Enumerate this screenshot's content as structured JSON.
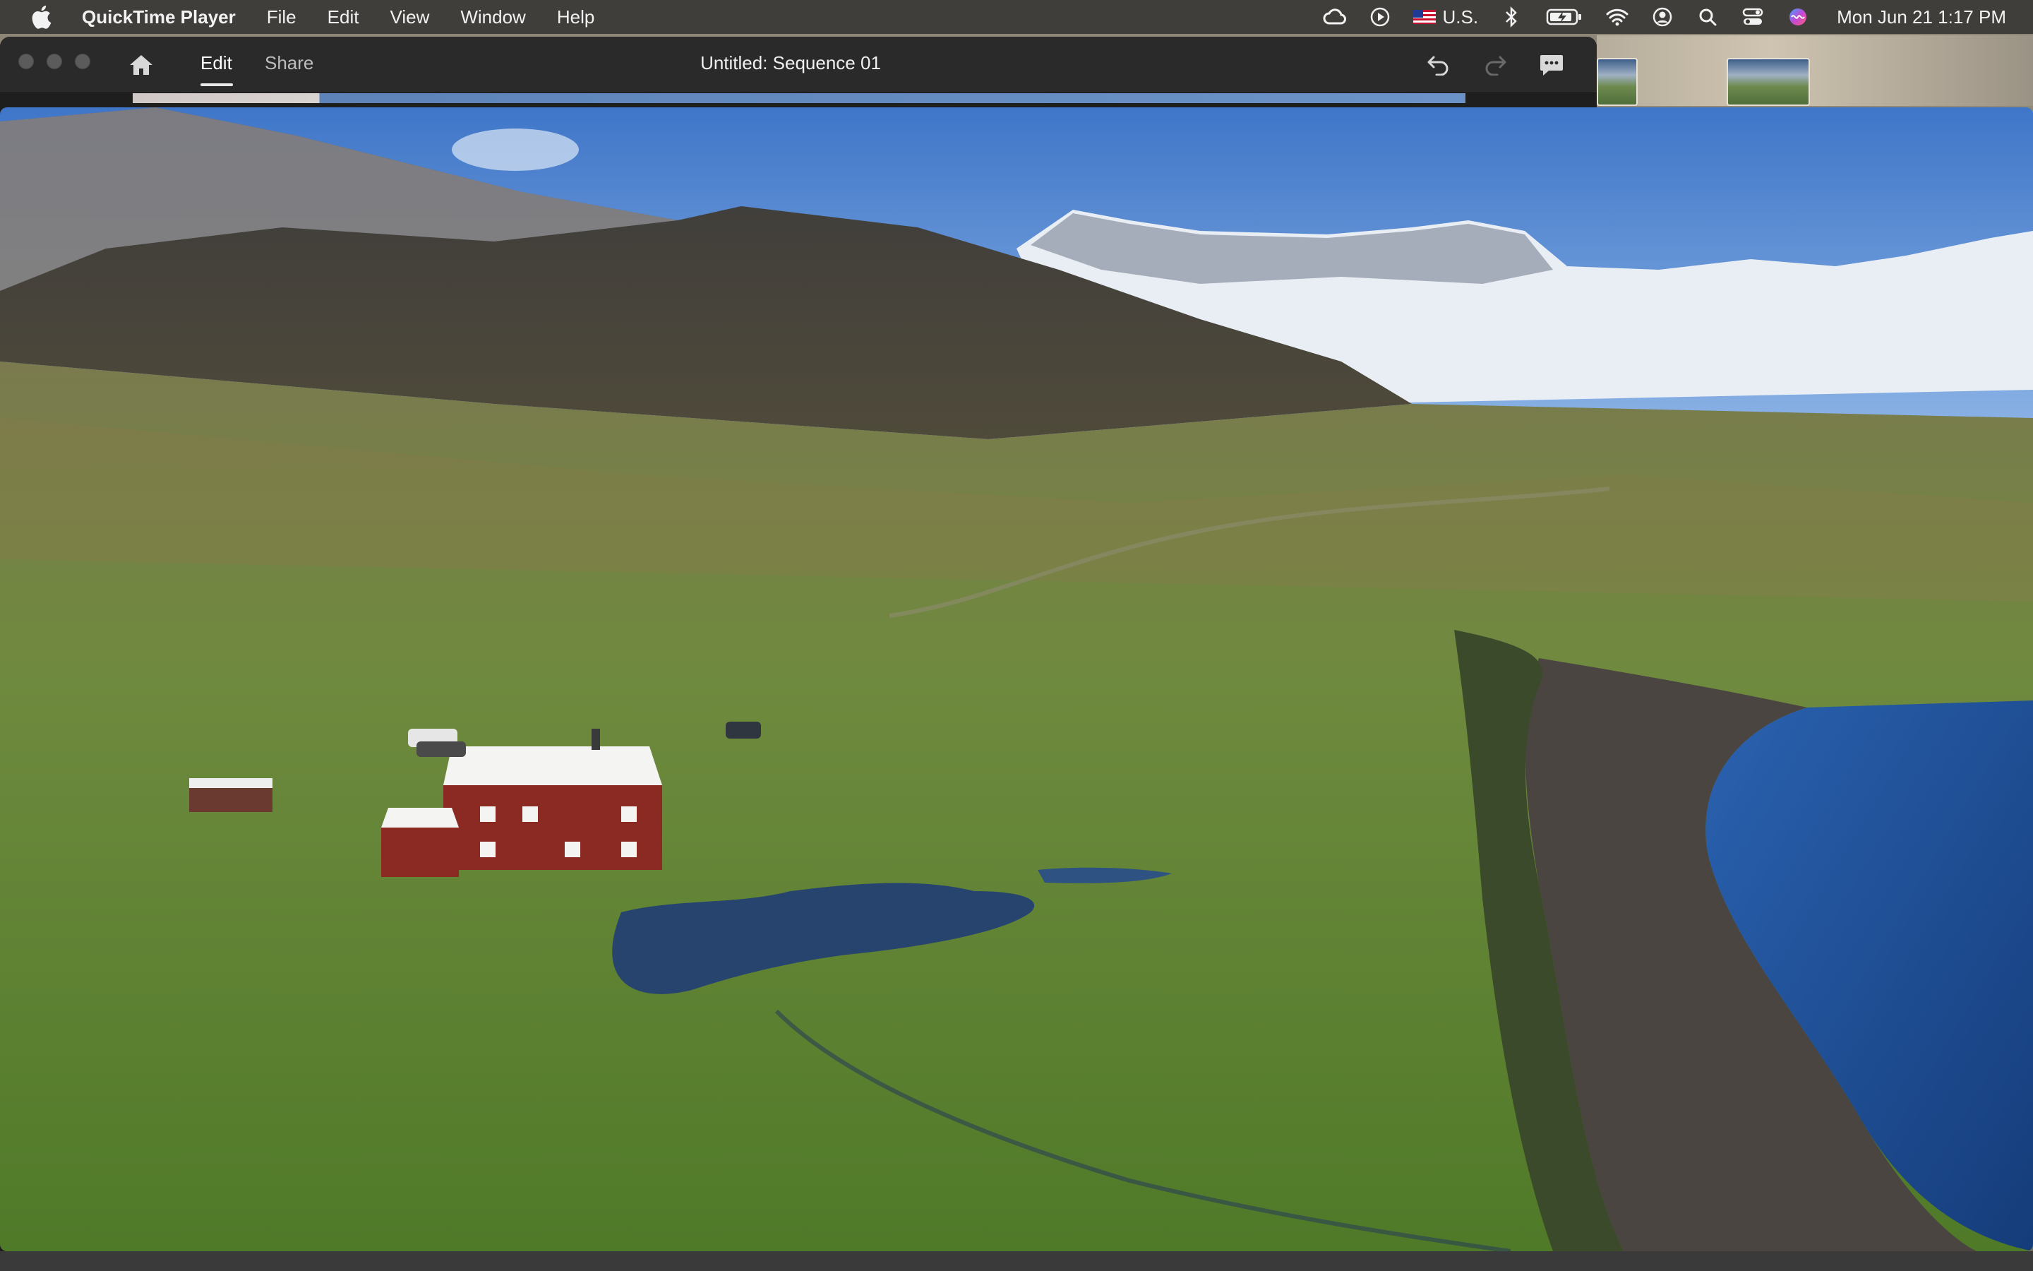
{
  "menubar": {
    "app_name": "QuickTime Player",
    "items": [
      "File",
      "Edit",
      "View",
      "Window",
      "Help"
    ],
    "input_source": "U.S.",
    "clock": "Mon Jun 21  1:17 PM"
  },
  "window": {
    "title": "Untitled: Sequence 01",
    "tabs": [
      {
        "label": "Edit",
        "active": true
      },
      {
        "label": "Share",
        "active": false
      }
    ]
  },
  "icons": {
    "apple": "apple-icon",
    "home": "home-icon",
    "undo": "undo-icon",
    "redo": "redo-icon",
    "comments": "speech-bubble-icon",
    "status": [
      "creative-cloud-icon",
      "play-circle-icon",
      "bluetooth-icon",
      "battery-charging-icon",
      "wifi-icon",
      "user-circle-icon",
      "search-icon",
      "control-center-icon",
      "siri-icon"
    ]
  },
  "colors": {
    "menubar_bg": "#3a3836",
    "window_chrome": "#2a2a2a",
    "sky": "#4f86d4",
    "grass": "#5e8a32",
    "sea": "#1f4f96",
    "house_red": "#8a2a22"
  }
}
